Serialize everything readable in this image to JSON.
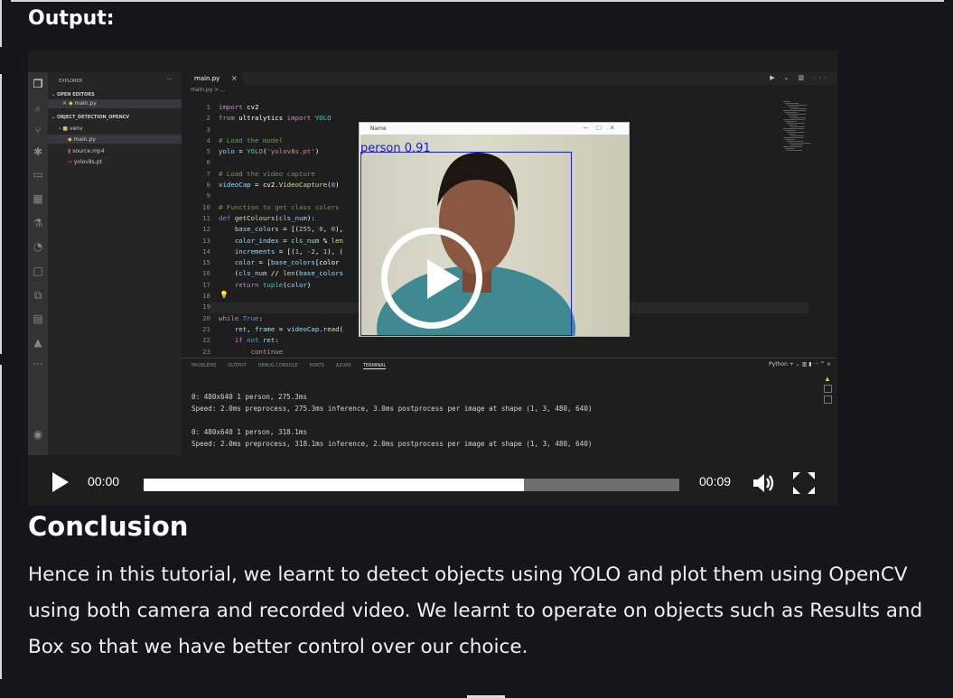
{
  "heading": "Output:",
  "vscode": {
    "explorer_title": "EXPLORER",
    "explorer_more": "···",
    "open_editors": "OPEN EDITORS",
    "open_editor_file": "main.py",
    "project": "OBJECT_DETECTION_OPENCV",
    "tree": [
      "venv",
      "main.py",
      "source.mp4",
      "yolov8s.pt"
    ],
    "tab_label": "main.py",
    "breadcrumb": "main.py > ...",
    "code_lines": [
      {
        "n": "1",
        "html": "<span class='k'>import</span> cv2"
      },
      {
        "n": "2",
        "html": "<span class='k'>from</span> ultralytics <span class='k'>import</span> <span class='t'>YOLO</span>"
      },
      {
        "n": "3",
        "html": ""
      },
      {
        "n": "4",
        "html": "<span class='c'># Load the model</span>"
      },
      {
        "n": "5",
        "html": "<span class='v'>yolo</span> = <span class='t'>YOLO</span>(<span class='s'>'yolov8s.pt'</span>)"
      },
      {
        "n": "6",
        "html": ""
      },
      {
        "n": "7",
        "html": "<span class='c'># Load the video capture</span>"
      },
      {
        "n": "8",
        "html": "<span class='v'>videoCap</span> = cv2.<span class='f'>VideoCapture</span>(<span class='n'>0</span>)"
      },
      {
        "n": "9",
        "html": ""
      },
      {
        "n": "10",
        "html": "<span class='c'># Function to get class colors</span>"
      },
      {
        "n": "11",
        "html": "<span class='b'>def</span> <span class='f'>getColours</span>(<span class='v'>cls_num</span>):"
      },
      {
        "n": "12",
        "html": "    <span class='v'>base_colors</span> = [(<span class='n'>255</span>, <span class='n'>0</span>, <span class='n'>0</span>),"
      },
      {
        "n": "13",
        "html": "    <span class='v'>color_index</span> = <span class='v'>cls_num</span> % <span class='f'>len</span>"
      },
      {
        "n": "14",
        "html": "    <span class='v'>increments</span> = [(<span class='n'>1</span>, <span class='n'>-2</span>, <span class='n'>1</span>), ("
      },
      {
        "n": "15",
        "html": "    <span class='v'>color</span> = [<span class='v'>base_colors</span>[color"
      },
      {
        "n": "16",
        "html": "    (<span class='v'>cls_num</span> // <span class='f'>len</span>(<span class='v'>base_colors</span>"
      },
      {
        "n": "17",
        "html": "    <span class='k'>return</span> <span class='t'>tuple</span>(<span class='v'>color</span>)"
      },
      {
        "n": "18",
        "html": ""
      },
      {
        "n": "19",
        "html": ""
      },
      {
        "n": "20",
        "html": "<span class='k'>while</span> <span class='b'>True</span>:"
      },
      {
        "n": "21",
        "html": "    <span class='v'>ret</span>, <span class='v'>frame</span> = <span class='v'>videoCap</span>.<span class='f'>read</span>("
      },
      {
        "n": "22",
        "html": "    <span class='k'>if</span> <span class='b'>not</span> <span class='v'>ret</span>:"
      },
      {
        "n": "23",
        "html": "        <span class='k'>continue</span>"
      }
    ],
    "panel_tabs": [
      "PROBLEMS",
      "OUTPUT",
      "DEBUG CONSOLE",
      "PORTS",
      "AZURE",
      "TERMINAL"
    ],
    "panel_actions": "Python  +  ⌄  ▥  ▮  ···  ^  ×",
    "terminal": [
      "0: 480x640 1 person, 275.3ms",
      "Speed: 2.0ms preprocess, 275.3ms inference, 3.0ms postprocess per image at shape (1, 3, 480, 640)",
      "",
      "0: 480x640 1 person, 318.1ms",
      "Speed: 2.0ms preprocess, 318.1ms inference, 2.0ms postprocess per image at shape (1, 3, 480, 640)"
    ],
    "camera_window_title": "Name",
    "detection_label": "person 0.91"
  },
  "player": {
    "current_time": "00:00",
    "duration": "00:09",
    "progress_fraction": 0.71
  },
  "conclusion": {
    "title": "Conclusion",
    "text": "Hence in this tutorial, we learnt to detect objects using YOLO and plot them using OpenCV using both camera and recorded video. We learnt to operate on objects such as Results and Box so that we have better control over our choice."
  }
}
